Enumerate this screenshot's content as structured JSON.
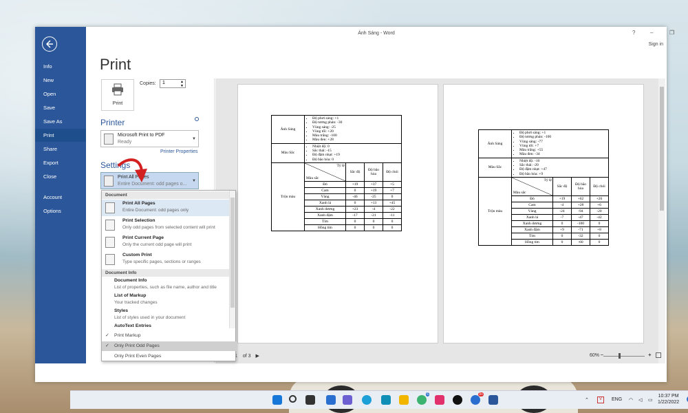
{
  "window": {
    "title": "Ánh Sáng - Word",
    "help": "?",
    "minimize": "–",
    "restore": "❐",
    "close": "✕",
    "sign_in": "Sign in"
  },
  "backstage": {
    "items": [
      "Info",
      "New",
      "Open",
      "Save",
      "Save As",
      "Print",
      "Share",
      "Export",
      "Close",
      "Account",
      "Options"
    ],
    "active": "Print"
  },
  "print": {
    "heading": "Print",
    "button_label": "Print",
    "copies_label": "Copies:",
    "copies_value": "1",
    "printer_heading": "Printer",
    "printer_name": "Microsoft Print to PDF",
    "printer_status": "Ready",
    "printer_properties": "Printer Properties",
    "settings_heading": "Settings",
    "setting_name": "Print All Pages",
    "setting_desc": "Entire Document: odd pages o..."
  },
  "menu": {
    "document_header": "Document",
    "items": [
      {
        "name": "Print All Pages",
        "desc": "Entire Document: odd pages only"
      },
      {
        "name": "Print Selection",
        "desc": "Only odd pages from selected content will print"
      },
      {
        "name": "Print Current Page",
        "desc": "Only the current odd page will print"
      },
      {
        "name": "Custom Print",
        "desc": "Type specific pages, sections or ranges"
      }
    ],
    "docinfo_header": "Document Info",
    "info_items": [
      {
        "name": "Document Info",
        "desc": "List of properties, such as file name, author and title"
      },
      {
        "name": "List of Markup",
        "desc": "Your tracked changes"
      },
      {
        "name": "Styles",
        "desc": "List of styles used in your document"
      },
      {
        "name": "AutoText Entries",
        "desc": ""
      }
    ],
    "checks": [
      {
        "label": "Print Markup",
        "checked": true
      },
      {
        "label": "Only Print Odd Pages",
        "checked": true
      },
      {
        "label": "Only Print Even Pages",
        "checked": false
      }
    ]
  },
  "pager": {
    "current": "1",
    "of_label": "of 3"
  },
  "zoom": {
    "level": "60%",
    "minus": "–",
    "plus": "+"
  },
  "page1": {
    "anh_sang": {
      "label": "Ánh Sáng",
      "items": [
        "Độ phơi sáng: +1",
        "Độ tương phản: -30",
        "Vùng sáng: -25",
        "Vùng tối: +20",
        "Màu trắng: -100",
        "Màu đen: +28"
      ]
    },
    "mau_sac": {
      "label": "Màu Sắc",
      "items": [
        "Nhiệt độ: 0",
        "Sắc thái: -15",
        "Độ đậm nhạt: +19",
        "Độ bão hòa: 0"
      ]
    },
    "tron_mau": {
      "label": "Trộn màu",
      "diag_top": "Tỷ lệ",
      "diag_bottom": "Màu sắc",
      "headers": [
        "Sắc độ",
        "Độ bão hòa",
        "Độ chói"
      ],
      "rows": [
        {
          "c": "Đỏ",
          "v": [
            "+19",
            "+37",
            "+5"
          ]
        },
        {
          "c": "Cam",
          "v": [
            "0",
            "+19",
            "+7"
          ]
        },
        {
          "c": "Vàng",
          "v": [
            "-46",
            "-25",
            "0"
          ]
        },
        {
          "c": "Xanh lá",
          "v": [
            "0",
            "+13",
            "+45"
          ]
        },
        {
          "c": "Xanh dương",
          "v": [
            "+23",
            "-4",
            "-22"
          ]
        },
        {
          "c": "Xanh đậm",
          "v": [
            "-17",
            "-21",
            "-11"
          ]
        },
        {
          "c": "Tím",
          "v": [
            "0",
            "0",
            "0"
          ]
        },
        {
          "c": "Hồng tím",
          "v": [
            "0",
            "0",
            "0"
          ]
        }
      ]
    }
  },
  "page2": {
    "anh_sang": {
      "label": "Ánh Sáng",
      "items": [
        "Độ phơi sáng: +1",
        "Độ tương phản: -100",
        "Vùng sáng: -77",
        "Vùng tối: +7",
        "Màu trắng: +55",
        "Màu đen: -34"
      ]
    },
    "mau_sac": {
      "label": "Màu Sắc",
      "items": [
        "Nhiệt độ: -10",
        "Sắc thái: -20",
        "Độ đậm nhạt: +47",
        "Độ bão hòa: +9"
      ]
    },
    "tron_mau": {
      "label": "Trộn màu",
      "diag_top": "Tỷ lệ",
      "diag_bottom": "Màu sắc",
      "headers": [
        "Sắc độ",
        "Độ bão hòa",
        "Độ chói"
      ],
      "rows": [
        {
          "c": "Đỏ",
          "v": [
            "+19",
            "+62",
            "+26"
          ]
        },
        {
          "c": "Cam",
          "v": [
            "-4",
            "+28",
            "+6"
          ]
        },
        {
          "c": "Vàng",
          "v": [
            "-24",
            "-94",
            "-20"
          ]
        },
        {
          "c": "Xanh lá",
          "v": [
            "-7",
            "-47",
            "-42"
          ]
        },
        {
          "c": "Xanh dương",
          "v": [
            "0",
            "-100",
            "0"
          ]
        },
        {
          "c": "Xanh đậm",
          "v": [
            "+9",
            "-71",
            "+8"
          ]
        },
        {
          "c": "Tím",
          "v": [
            "0",
            "-32",
            "0"
          ]
        },
        {
          "c": "Hồng tím",
          "v": [
            "0",
            "-60",
            "0"
          ]
        }
      ]
    }
  },
  "taskbar": {
    "lang": "ENG",
    "time": "10:37 PM",
    "date": "1/22/2022",
    "notif": "5",
    "badge_edge": "6",
    "badge_msg": "9+"
  }
}
